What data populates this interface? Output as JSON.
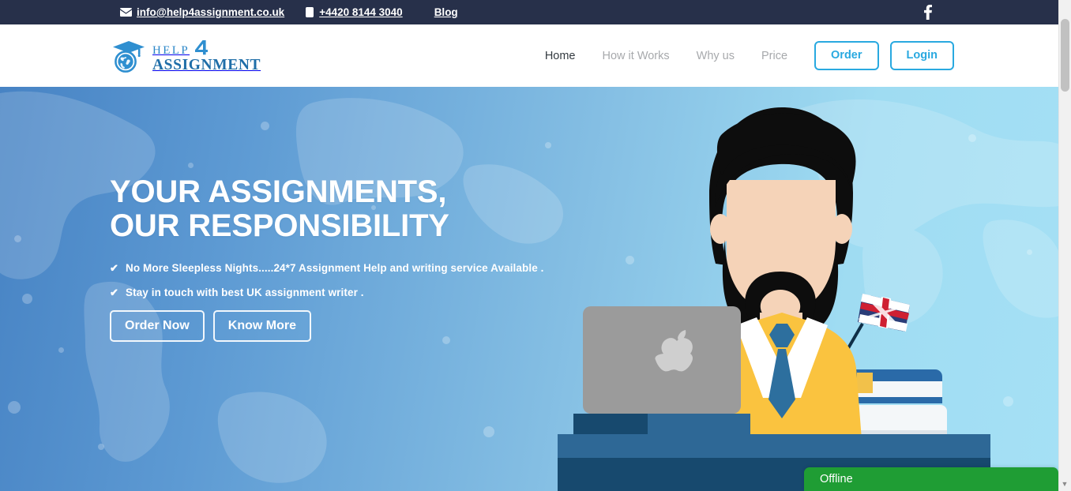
{
  "topbar": {
    "email": "info@help4assignment.co.uk",
    "email_icon": "envelope-icon",
    "phone": "+4420 8144 3040",
    "phone_icon": "phone-icon",
    "blog": "Blog",
    "social_icon": "facebook-icon",
    "background": "#27304a"
  },
  "logo": {
    "mark_icon": "graduation-cap-globe-icon",
    "word_help": "HELP",
    "word_four": "4",
    "word_assignment": "ASSIGNMENT",
    "color_primary": "#2a86c8",
    "color_secondary": "#1f6ea8"
  },
  "nav": {
    "links": [
      {
        "label": "Home",
        "active": true
      },
      {
        "label": "How it Works",
        "active": false
      },
      {
        "label": "Why us",
        "active": false
      },
      {
        "label": "Price",
        "active": false
      }
    ],
    "order_label": "Order",
    "login_label": "Login",
    "accent": "#29a9e0",
    "active_color": "#333a40",
    "inactive_color": "#a7a9ac"
  },
  "hero": {
    "headline": "YOUR ASSIGNMENTS,\nOUR RESPONSIBILITY",
    "bullets": [
      {
        "check_icon": "check-icon",
        "text": "No More Sleepless Nights.....24*7 Assignment Help and writing service Available ."
      },
      {
        "check_icon": "check-icon",
        "text": "Stay in touch with best UK assignment writer ."
      }
    ],
    "primary_cta": "Order Now",
    "secondary_cta": "Know More",
    "gradient_from": "#4783c4",
    "gradient_to": "#a5e0f5",
    "illustration": {
      "name": "student-at-desk-illustration",
      "hair_color": "#0d0d0d",
      "skin_color": "#f5d3b8",
      "sweater_color": "#fbc githubusercontent",
      "sweater": "#fac33f",
      "shirt_color": "#ffffff",
      "tie_color": "#2d6f9e",
      "laptop_color": "#9b9b9b",
      "desk_color": "#2e6896",
      "desk_dark": "#17496e",
      "book_blue": "#2a6aa8",
      "book_red": "#e23b35",
      "book_white": "#f4f7f9",
      "bookmark_color": "#f2c14a",
      "flag_icon": "union-jack-flag-icon",
      "laptop_logo_icon": "apple-logo-icon"
    }
  },
  "chat": {
    "status_label": "Offline",
    "background": "#1f9d34"
  },
  "scrollbar": {
    "thumb_color": "#c1c1c1",
    "track_color": "#f1f1f1",
    "down_arrow_icon": "chevron-down-icon"
  }
}
